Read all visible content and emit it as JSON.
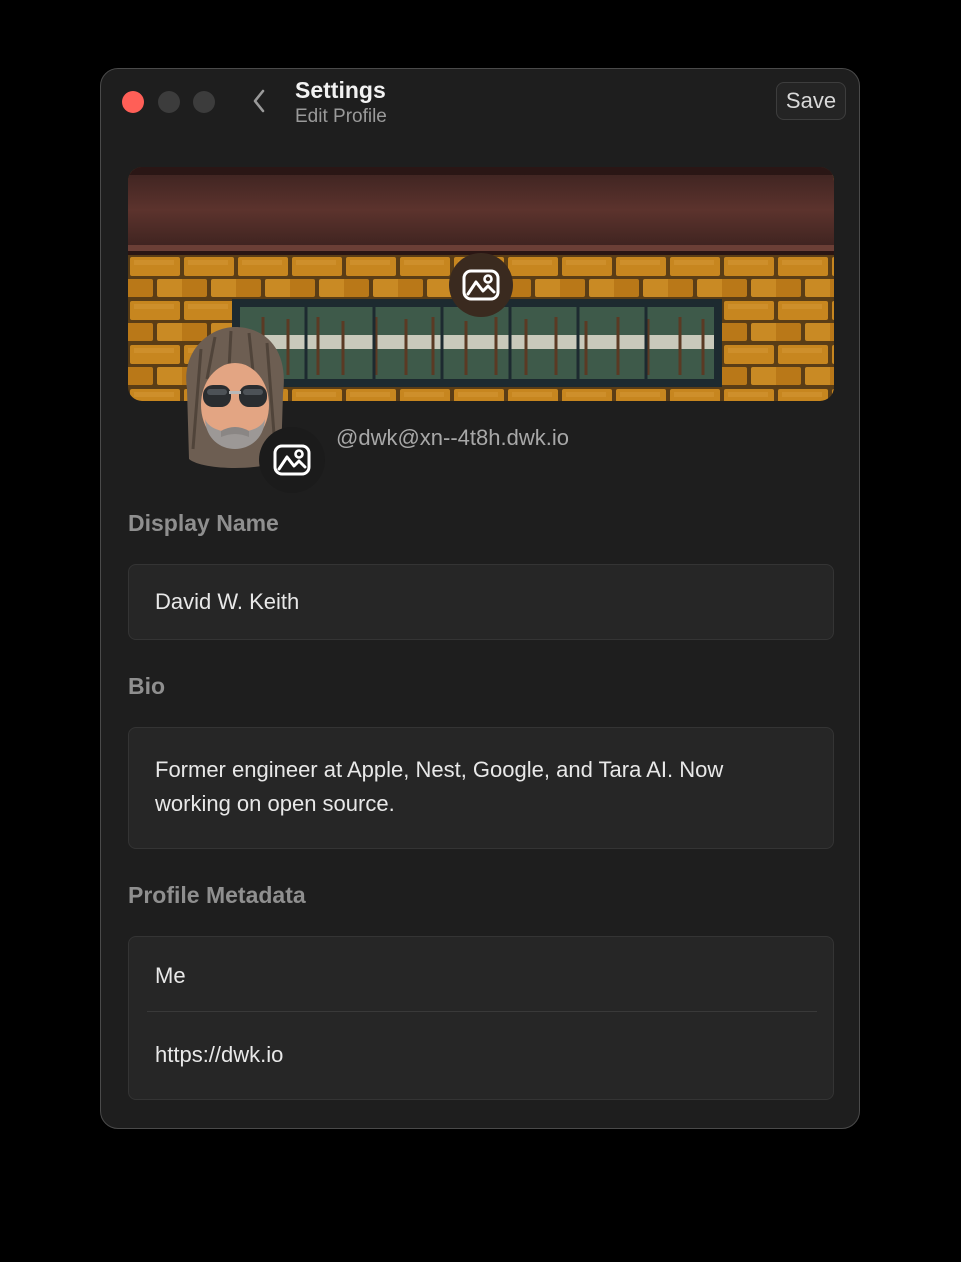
{
  "window": {
    "title": "Settings",
    "subtitle": "Edit Profile",
    "save_label": "Save"
  },
  "profile": {
    "handle": "@dwk@xn--4t8h.dwk.io"
  },
  "form": {
    "display_name_label": "Display Name",
    "display_name_value": "David W. Keith",
    "bio_label": "Bio",
    "bio_value": "Former engineer at Apple, Nest, Google, and Tara AI. Now working on open source.",
    "metadata_label": "Profile Metadata",
    "metadata": [
      {
        "value": "Me"
      },
      {
        "value": "https://dwk.io"
      }
    ]
  },
  "icons": {
    "back": "chevron-left-icon",
    "edit_banner": "photo-edit-icon",
    "edit_avatar": "photo-edit-icon"
  },
  "colors": {
    "close": "#ff5f57",
    "window_bg": "#1e1e1e",
    "field_bg": "#262626"
  }
}
